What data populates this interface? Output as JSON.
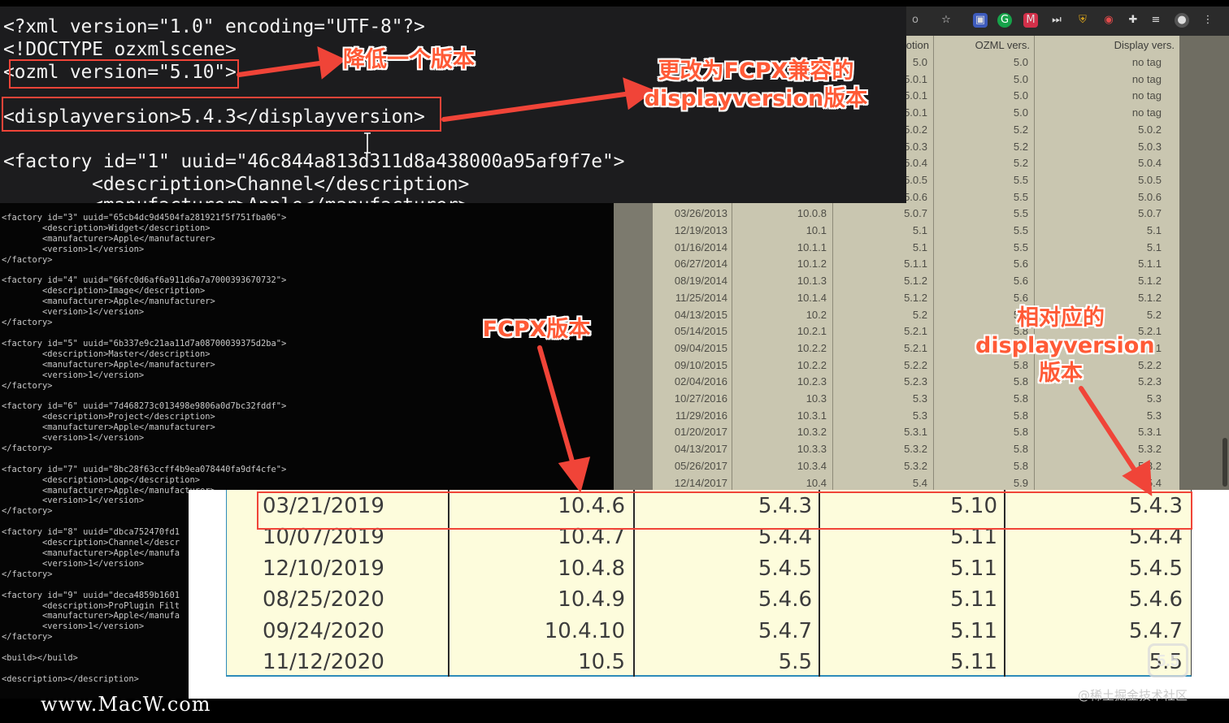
{
  "zoom_code": {
    "lines": [
      "<?xml version=\"1.0\" encoding=\"UTF-8\"?>",
      "<!DOCTYPE ozxmlscene>",
      "<ozml version=\"5.10\">",
      "<displayversion>5.4.3</displayversion>",
      "<factory id=\"1\" uuid=\"46c844a813d311d8a438000a95af9f7e\">",
      "        <description>Channel</description>",
      "        <manufacturer>Apple</manufacturer>"
    ]
  },
  "bg_code": {
    "text": "<factory id=\"3\" uuid=\"65cb4dc9d4504fa281921f5f751fba06\">\n        <description>Widget</description>\n        <manufacturer>Apple</manufacturer>\n        <version>1</version>\n</factory>\n\n<factory id=\"4\" uuid=\"66fc0d6af6a911d6a7a7000393670732\">\n        <description>Image</description>\n        <manufacturer>Apple</manufacturer>\n        <version>1</version>\n</factory>\n\n<factory id=\"5\" uuid=\"6b337e9c21aa11d7a08700039375d2ba\">\n        <description>Master</description>\n        <manufacturer>Apple</manufacturer>\n        <version>1</version>\n</factory>\n\n<factory id=\"6\" uuid=\"7d468273c013498e9806a0d7bc32fddf\">\n        <description>Project</description>\n        <manufacturer>Apple</manufacturer>\n        <version>1</version>\n</factory>\n\n<factory id=\"7\" uuid=\"8bc28f63ccff4b9ea078440fa9df4cfe\">\n        <description>Loop</description>\n        <manufacturer>Apple</manufacturer>\n        <version>1</version>\n</factory>\n\n<factory id=\"8\" uuid=\"dbca752470fd1\n        <description>Channel</descr\n        <manufacturer>Apple</manufa\n        <version>1</version>\n</factory>\n\n<factory id=\"9\" uuid=\"deca4859b1601\n        <description>ProPlugin Filt\n        <manufacturer>Apple</manufa\n        <version>1</version>\n</factory>\n\n<build></build>\n\n<description></description>"
  },
  "bg_table": {
    "headers": [
      "Motion",
      "OZML vers.",
      "Display vers."
    ],
    "rows": [
      [
        "",
        "",
        "5.0",
        "5.0",
        "no tag"
      ],
      [
        "",
        "",
        "5.0.1",
        "5.0",
        "no tag"
      ],
      [
        "",
        "",
        "5.0.1",
        "5.0",
        "no tag"
      ],
      [
        "",
        "",
        "5.0.1",
        "5.0",
        "no tag"
      ],
      [
        "",
        "",
        "5.0.2",
        "5.2",
        "5.0.2"
      ],
      [
        "",
        "",
        "5.0.3",
        "5.2",
        "5.0.3"
      ],
      [
        "",
        "",
        "5.0.4",
        "5.2",
        "5.0.4"
      ],
      [
        "",
        "",
        "5.0.5",
        "5.5",
        "5.0.5"
      ],
      [
        "",
        "",
        "5.0.6",
        "5.5",
        "5.0.6"
      ],
      [
        "03/26/2013",
        "10.0.8",
        "5.0.7",
        "5.5",
        "5.0.7"
      ],
      [
        "12/19/2013",
        "10.1",
        "5.1",
        "5.5",
        "5.1"
      ],
      [
        "01/16/2014",
        "10.1.1",
        "5.1",
        "5.5",
        "5.1"
      ],
      [
        "06/27/2014",
        "10.1.2",
        "5.1.1",
        "5.6",
        "5.1.1"
      ],
      [
        "08/19/2014",
        "10.1.3",
        "5.1.2",
        "5.6",
        "5.1.2"
      ],
      [
        "11/25/2014",
        "10.1.4",
        "5.1.2",
        "5.6",
        "5.1.2"
      ],
      [
        "04/13/2015",
        "10.2",
        "5.2",
        "5.8",
        "5.2"
      ],
      [
        "05/14/2015",
        "10.2.1",
        "5.2.1",
        "5.8",
        "5.2.1"
      ],
      [
        "09/04/2015",
        "10.2.2",
        "5.2.1",
        "5.8",
        "5.2.1"
      ],
      [
        "09/10/2015",
        "10.2.2",
        "5.2.2",
        "5.8",
        "5.2.2"
      ],
      [
        "02/04/2016",
        "10.2.3",
        "5.2.3",
        "5.8",
        "5.2.3"
      ],
      [
        "10/27/2016",
        "10.3",
        "5.3",
        "5.8",
        "5.3"
      ],
      [
        "11/29/2016",
        "10.3.1",
        "5.3",
        "5.8",
        "5.3"
      ],
      [
        "01/20/2017",
        "10.3.2",
        "5.3.1",
        "5.8",
        "5.3.1"
      ],
      [
        "04/13/2017",
        "10.3.3",
        "5.3.2",
        "5.8",
        "5.3.2"
      ],
      [
        "05/26/2017",
        "10.3.4",
        "5.3.2",
        "5.8",
        "5.3.2"
      ],
      [
        "12/14/2017",
        "10.4",
        "5.4",
        "5.9",
        "5.4"
      ]
    ]
  },
  "zoom_table": {
    "rows": [
      [
        "03/21/2019",
        "10.4.6",
        "5.4.3",
        "5.10",
        "5.4.3"
      ],
      [
        "10/07/2019",
        "10.4.7",
        "5.4.4",
        "5.11",
        "5.4.4"
      ],
      [
        "12/10/2019",
        "10.4.8",
        "5.4.5",
        "5.11",
        "5.4.5"
      ],
      [
        "08/25/2020",
        "10.4.9",
        "5.4.6",
        "5.11",
        "5.4.6"
      ],
      [
        "09/24/2020",
        "10.4.10",
        "5.4.7",
        "5.11",
        "5.4.7"
      ],
      [
        "11/12/2020",
        "10.5",
        "5.5",
        "5.11",
        "5.5"
      ]
    ]
  },
  "annotations": {
    "lower_version": "降低一个版本",
    "change_compat_line1": "更改为FCPX兼容的",
    "change_compat_line2": "displayversion版本",
    "fcpx_version": "FCPX版本",
    "corresponding_line1": "相对应的",
    "corresponding_line2": "displayversion",
    "corresponding_line3": "版本"
  },
  "browser_icons": [
    "star-icon",
    "extension-icon",
    "grammarly-icon",
    "extension-icon-2",
    "media-icon",
    "shield-icon",
    "extension-icon-3",
    "puzzle-icon",
    "list-icon",
    "profile-icon",
    "menu-icon"
  ],
  "watermark": "www.MacW.com",
  "credit": "@稀土掘金技术社区",
  "logo_text": "5.5",
  "colors": {
    "annotation_red": "#f04438",
    "zoom_table_bg": "#fdfcdc",
    "zoom_table_border": "#2e8bb9"
  }
}
